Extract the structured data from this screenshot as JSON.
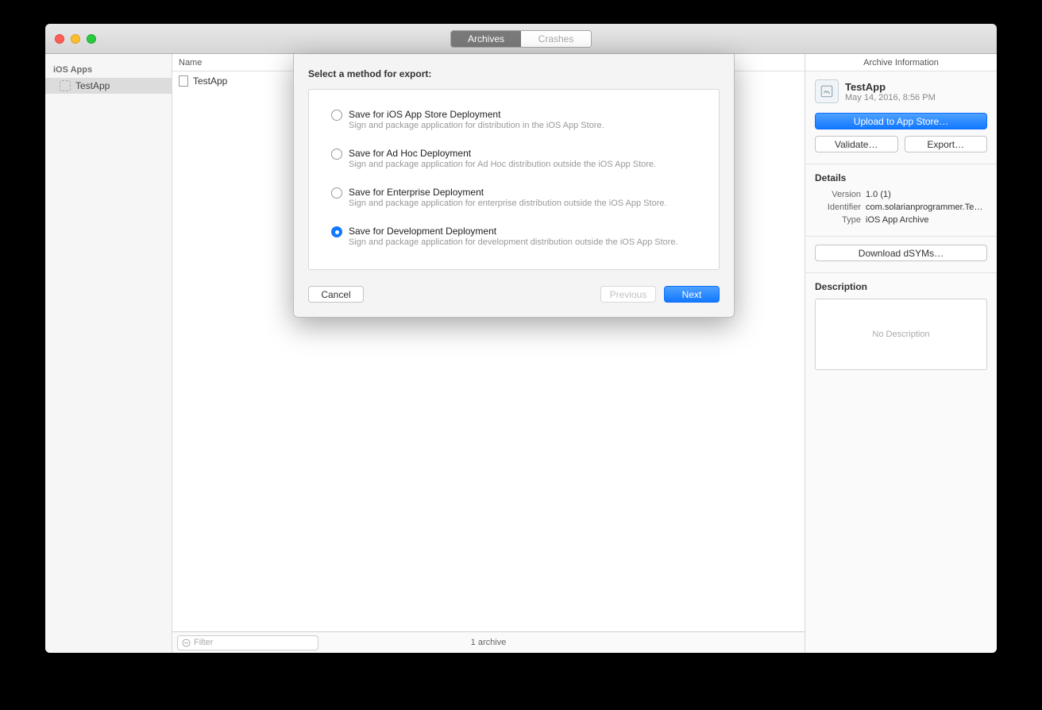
{
  "titlebar": {
    "tabs": {
      "archives": "Archives",
      "crashes": "Crashes"
    }
  },
  "sidebar": {
    "section": "iOS Apps",
    "item": "TestApp"
  },
  "list": {
    "header": "Name",
    "rowName": "TestApp"
  },
  "bottom": {
    "filterPlaceholder": "Filter",
    "count": "1 archive"
  },
  "right": {
    "title": "Archive Information",
    "appName": "TestApp",
    "appDate": "May 14, 2016, 8:56 PM",
    "uploadBtn": "Upload to App Store…",
    "validateBtn": "Validate…",
    "exportBtn": "Export…",
    "detailsTitle": "Details",
    "details": {
      "versionK": "Version",
      "versionV": "1.0 (1)",
      "identifierK": "Identifier",
      "identifierV": "com.solarianprogrammer.Te…",
      "typeK": "Type",
      "typeV": "iOS App Archive"
    },
    "dsymBtn": "Download dSYMs…",
    "descTitle": "Description",
    "descEmpty": "No Description"
  },
  "modal": {
    "title": "Select a method for export:",
    "options": [
      {
        "label": "Save for iOS App Store Deployment",
        "desc": "Sign and package application for distribution in the iOS App Store."
      },
      {
        "label": "Save for Ad Hoc Deployment",
        "desc": "Sign and package application for Ad Hoc distribution outside the iOS App Store."
      },
      {
        "label": "Save for Enterprise Deployment",
        "desc": "Sign and package application for enterprise distribution outside the iOS App Store."
      },
      {
        "label": "Save for Development Deployment",
        "desc": "Sign and package application for development distribution outside the iOS App Store."
      }
    ],
    "selectedIndex": 3,
    "cancel": "Cancel",
    "previous": "Previous",
    "next": "Next"
  }
}
